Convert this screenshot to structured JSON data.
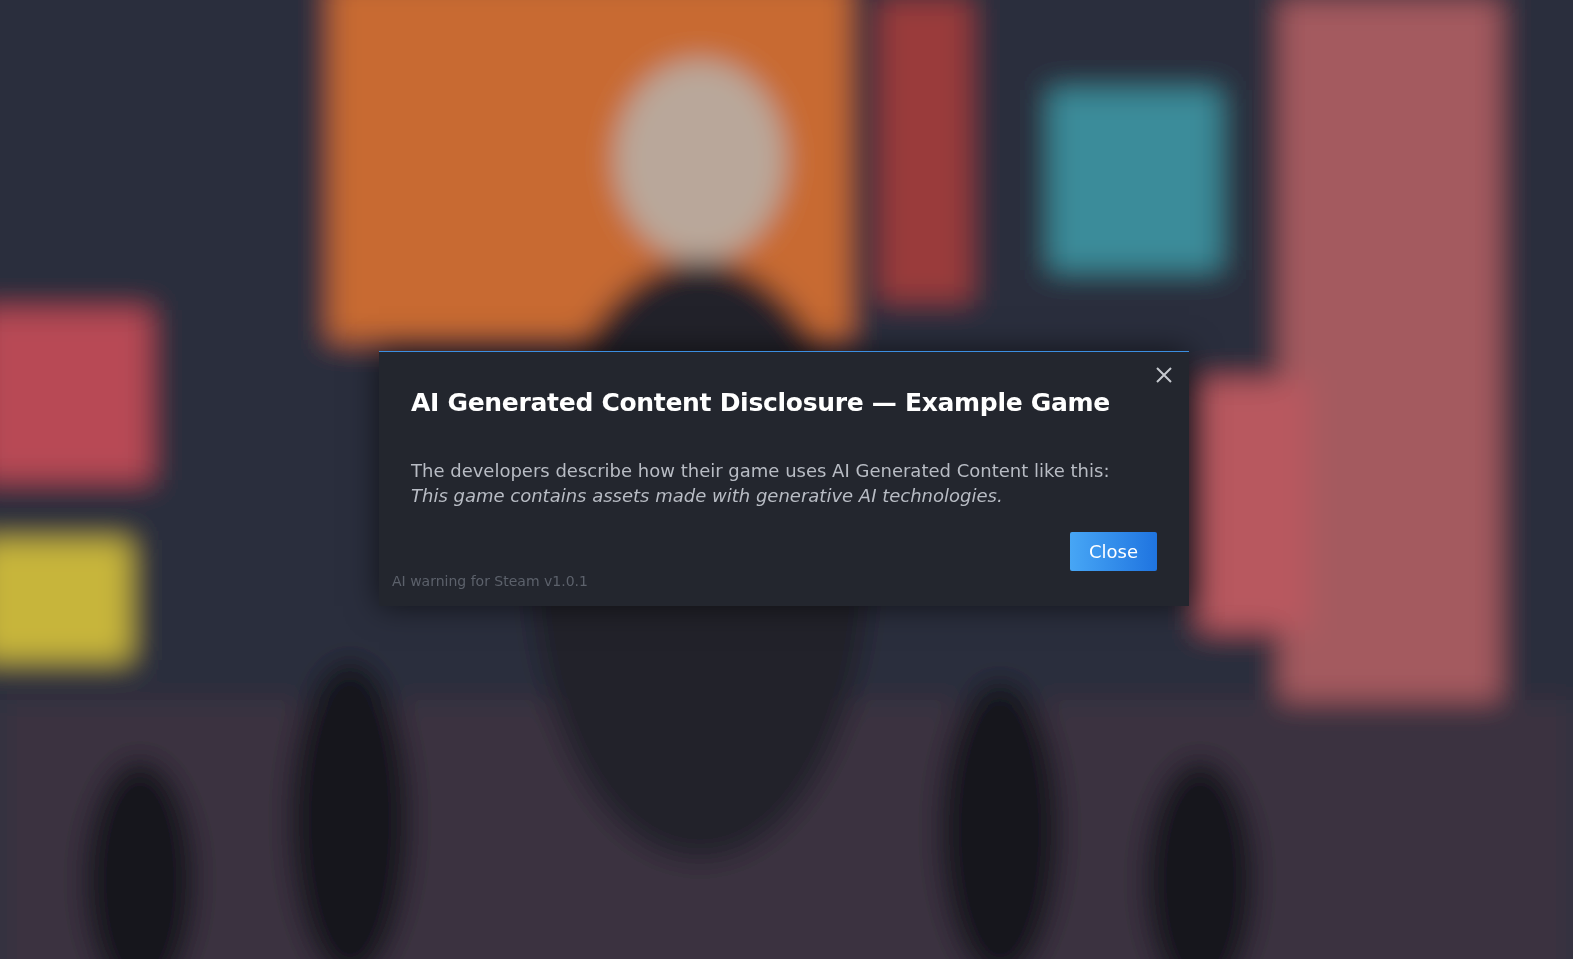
{
  "dialog": {
    "title": "AI Generated Content Disclosure — Example Game",
    "description": "The developers describe how their game uses AI Generated Content like this:",
    "quote": "This game contains assets made with generative AI technologies.",
    "buttons": [
      {
        "label": "Close",
        "kind": "primary"
      }
    ],
    "footer": "AI warning for Steam v1.0.1"
  }
}
